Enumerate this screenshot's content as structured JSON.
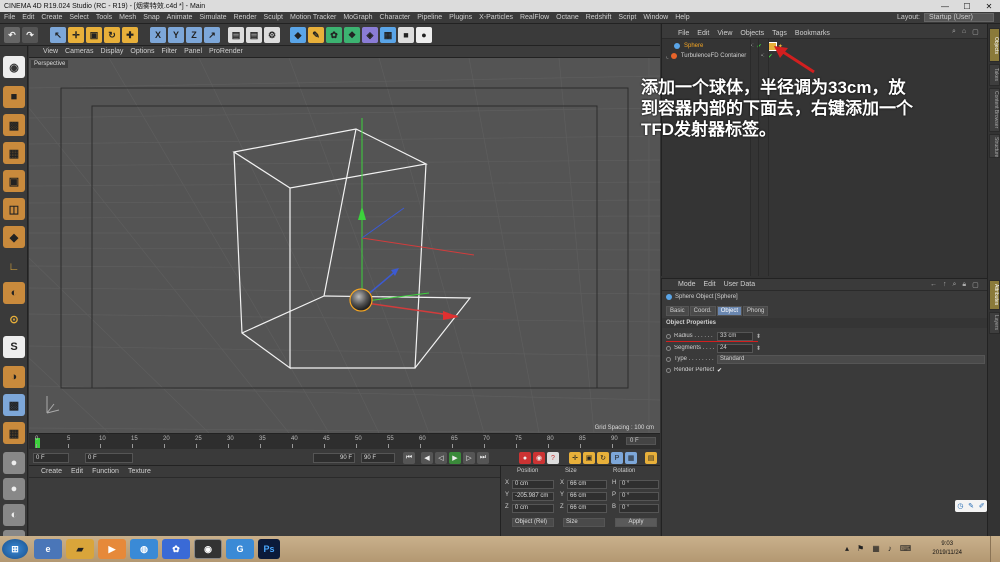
{
  "title": "CINEMA 4D R19.024 Studio (RC - R19) - [烟雾特效.c4d *] - Main",
  "menu": [
    "File",
    "Edit",
    "Create",
    "Select",
    "Tools",
    "Mesh",
    "Snap",
    "Animate",
    "Simulate",
    "Render",
    "Sculpt",
    "Motion Tracker",
    "MoGraph",
    "Character",
    "Pipeline",
    "Plugins",
    "X-Particles",
    "RealFlow",
    "Octane",
    "Redshift",
    "Script",
    "Window",
    "Help"
  ],
  "layout": {
    "label": "Layout:",
    "value": "Startup (User)"
  },
  "viewport_menu": [
    "View",
    "Cameras",
    "Display",
    "Options",
    "Filter",
    "Panel",
    "ProRender"
  ],
  "viewport": {
    "label": "Perspective",
    "grid_spacing": "Grid Spacing : 100 cm"
  },
  "timeline": {
    "ticks": [
      "0",
      "5",
      "10",
      "15",
      "20",
      "25",
      "30",
      "35",
      "40",
      "45",
      "50",
      "55",
      "60",
      "65",
      "70",
      "75",
      "80",
      "85",
      "90"
    ],
    "end_frame": "0 F"
  },
  "transport": {
    "current": "0 F",
    "start": "0 F",
    "min": "90 F",
    "max": "90 F"
  },
  "material_menu": [
    "Create",
    "Edit",
    "Function",
    "Texture"
  ],
  "coord": {
    "headers": [
      "Position",
      "Size",
      "Rotation"
    ],
    "rows": [
      {
        "a": "X",
        "p": "0 cm",
        "b": "X",
        "s": "66 cm",
        "c": "H",
        "r": "0 °"
      },
      {
        "a": "Y",
        "p": "-205.987 cm",
        "b": "Y",
        "s": "66 cm",
        "c": "P",
        "r": "0 °"
      },
      {
        "a": "Z",
        "p": "0 cm",
        "b": "Z",
        "s": "66 cm",
        "c": "B",
        "r": "0 °"
      }
    ],
    "mode": "Object (Rel)",
    "size_mode": "Size",
    "apply": "Apply"
  },
  "object_manager": {
    "menu": [
      "File",
      "Edit",
      "View",
      "Objects",
      "Tags",
      "Bookmarks"
    ],
    "objects": [
      {
        "name": "Sphere",
        "selected": true
      },
      {
        "name": "TurbulenceFD Container",
        "selected": false
      }
    ]
  },
  "attribute_manager": {
    "menu": [
      "Mode",
      "Edit",
      "User Data"
    ],
    "title": "Sphere Object [Sphere]",
    "tabs": [
      {
        "label": "Basic",
        "active": false
      },
      {
        "label": "Coord.",
        "active": false
      },
      {
        "label": "Object",
        "active": true
      },
      {
        "label": "Phong",
        "active": false
      }
    ],
    "section": "Object Properties",
    "fields": [
      {
        "label": "Radius . . . . . . . . . . .",
        "value": "33 cm"
      },
      {
        "label": "Segments . . . . . . . .",
        "value": "24"
      },
      {
        "label": "Type . . . . . . . . . . . . . .",
        "value": "Standard"
      },
      {
        "label": "Render Perfect",
        "value": "✔"
      }
    ]
  },
  "right_tabs": [
    "Objects",
    "Takes",
    "Content Browser",
    "Structure",
    "Attributes",
    "Layers"
  ],
  "callout": [
    "添加一个球体，半径调为33cm，放",
    "到容器内部的下面去，右键添加一个",
    "TFD发射器标签。"
  ],
  "clock": {
    "time": "9:03",
    "date": "2019/11/24"
  },
  "colors": {
    "accent": "#6a87b0",
    "callout_arrow": "#d21f1f",
    "selected_text": "#f5a623"
  }
}
